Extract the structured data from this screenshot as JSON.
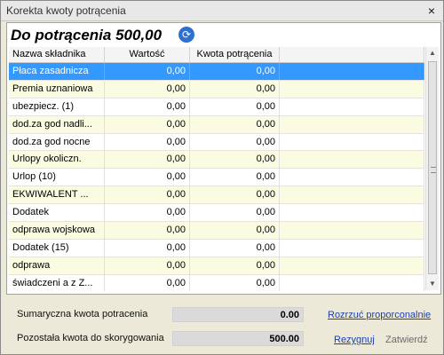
{
  "window": {
    "title": "Korekta kwoty potrącenia",
    "close_label": "×"
  },
  "header": {
    "title": "Do potrącenia 500,00"
  },
  "table": {
    "columns": [
      "Nazwa składnika",
      "Wartość",
      "Kwota potrącenia"
    ],
    "rows": [
      {
        "name": "Płaca zasadnicza",
        "value": "0,00",
        "deduction": "0,00"
      },
      {
        "name": "Premia uznaniowa",
        "value": "0,00",
        "deduction": "0,00"
      },
      {
        "name": "ubezpiecz. (1)",
        "value": "0,00",
        "deduction": "0,00"
      },
      {
        "name": "dod.za god nadli...",
        "value": "0,00",
        "deduction": "0,00"
      },
      {
        "name": "dod.za god nocne",
        "value": "0,00",
        "deduction": "0,00"
      },
      {
        "name": "Urlopy okoliczn.",
        "value": "0,00",
        "deduction": "0,00"
      },
      {
        "name": "Urlop (10)",
        "value": "0,00",
        "deduction": "0,00"
      },
      {
        "name": "EKWIWALENT ...",
        "value": "0,00",
        "deduction": "0,00"
      },
      {
        "name": "Dodatek",
        "value": "0,00",
        "deduction": "0,00"
      },
      {
        "name": "odprawa wojskowa",
        "value": "0,00",
        "deduction": "0,00"
      },
      {
        "name": "Dodatek (15)",
        "value": "0,00",
        "deduction": "0,00"
      },
      {
        "name": "odprawa",
        "value": "0,00",
        "deduction": "0,00"
      },
      {
        "name": "świadczeni a z Z...",
        "value": "0,00",
        "deduction": "0,00"
      }
    ],
    "selected_row": 0
  },
  "summary": {
    "total_label": "Sumaryczna kwota potracenia",
    "total_value": "0.00",
    "remaining_label": "Pozostała kwota do skorygowania",
    "remaining_value": "500.00"
  },
  "actions": {
    "distribute": "Rozrzuć proporconalnie",
    "cancel": "Rezygnuj",
    "confirm": "Zatwierdź"
  },
  "colors": {
    "selection": "#3399ff",
    "alt_row": "#fbfbe2",
    "link": "#1a3fb0"
  }
}
